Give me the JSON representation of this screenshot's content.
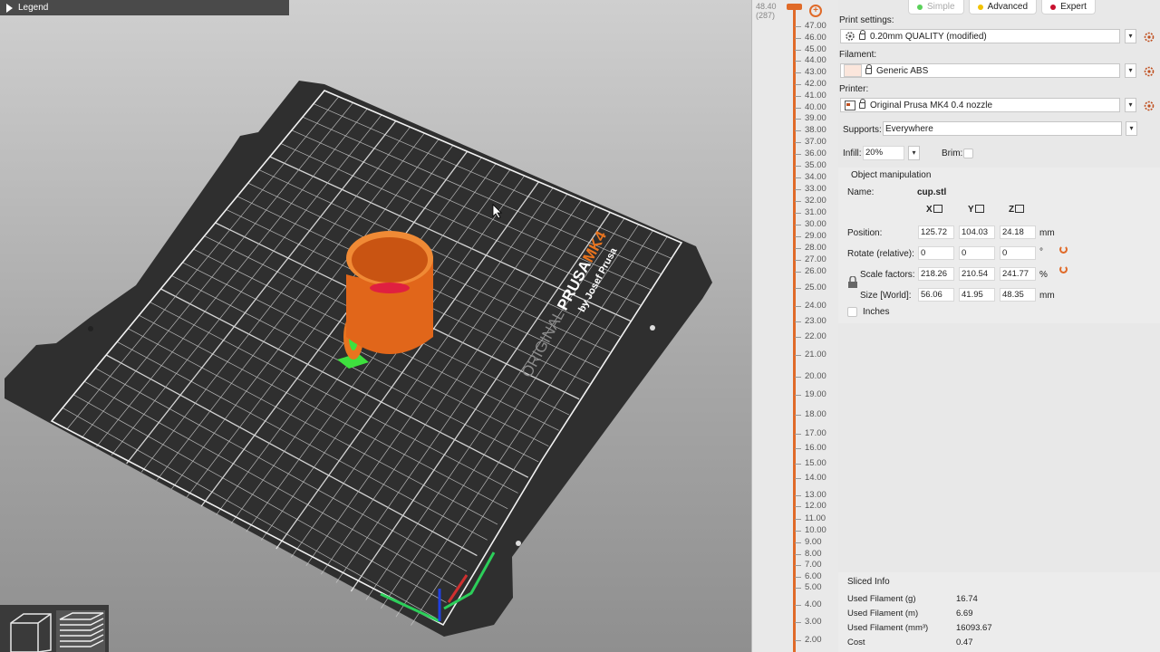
{
  "legend": {
    "label": "Legend"
  },
  "bed": {
    "brand_original": "ORIGINAL",
    "brand_prusa": "PRUSA",
    "brand_model": "MK4",
    "brand_by": "by Josef Prusa"
  },
  "layer_slider": {
    "top_height": "48.40",
    "top_layer": "(287)",
    "ticks": [
      "47.00",
      "46.00",
      "45.00",
      "44.00",
      "43.00",
      "42.00",
      "41.00",
      "40.00",
      "39.00",
      "38.00",
      "37.00",
      "36.00",
      "35.00",
      "34.00",
      "33.00",
      "32.00",
      "31.00",
      "30.00",
      "29.00",
      "28.00",
      "27.00",
      "26.00",
      "25.00",
      "24.00",
      "23.00",
      "22.00",
      "21.00",
      "20.00",
      "19.00",
      "18.00",
      "17.00",
      "16.00",
      "15.00",
      "14.00",
      "13.00",
      "12.00",
      "11.00",
      "10.00",
      "9.00",
      "8.00",
      "7.00",
      "6.00",
      "5.00",
      "4.00",
      "3.00",
      "2.00"
    ]
  },
  "modes": [
    {
      "label": "Simple",
      "color": "#5ad15a",
      "active": false
    },
    {
      "label": "Advanced",
      "color": "#f2c200",
      "active": true
    },
    {
      "label": "Expert",
      "color": "#c8102e",
      "active": true
    }
  ],
  "print_settings": {
    "label": "Print settings:",
    "value": "0.20mm QUALITY (modified)"
  },
  "filament": {
    "label": "Filament:",
    "value": "Generic ABS",
    "swatch": "#fbe6dc"
  },
  "printer": {
    "label": "Printer:",
    "value": "Original Prusa MK4 0.4 nozzle"
  },
  "supports": {
    "label": "Supports:",
    "value": "Everywhere"
  },
  "infill": {
    "label": "Infill:",
    "value": "20%"
  },
  "brim": {
    "label": "Brim:"
  },
  "object_manipulation": {
    "title": "Object manipulation",
    "name_label": "Name:",
    "name_value": "cup.stl",
    "axes": [
      "X",
      "Y",
      "Z"
    ],
    "position": {
      "label": "Position:",
      "values": [
        "125.72",
        "104.03",
        "24.18"
      ],
      "unit": "mm"
    },
    "rotate": {
      "label": "Rotate (relative):",
      "values": [
        "0",
        "0",
        "0"
      ],
      "unit": "°"
    },
    "scale": {
      "label": "Scale factors:",
      "values": [
        "218.26",
        "210.54",
        "241.77"
      ],
      "unit": "%"
    },
    "size": {
      "label": "Size [World]:",
      "values": [
        "56.06",
        "41.95",
        "48.35"
      ],
      "unit": "mm"
    },
    "inches_label": "Inches"
  },
  "sliced_info": {
    "title": "Sliced Info",
    "rows": [
      {
        "label": "Used Filament (g)",
        "value": "16.74"
      },
      {
        "label": "Used Filament (m)",
        "value": "6.69"
      },
      {
        "label": "Used Filament (mm³)",
        "value": "16093.67"
      },
      {
        "label": "Cost",
        "value": "0.47"
      }
    ]
  },
  "colors": {
    "accent": "#e06a28",
    "cup": "#e8741f",
    "bed": "#2f2f2f",
    "grid": "#d8d8d8"
  }
}
